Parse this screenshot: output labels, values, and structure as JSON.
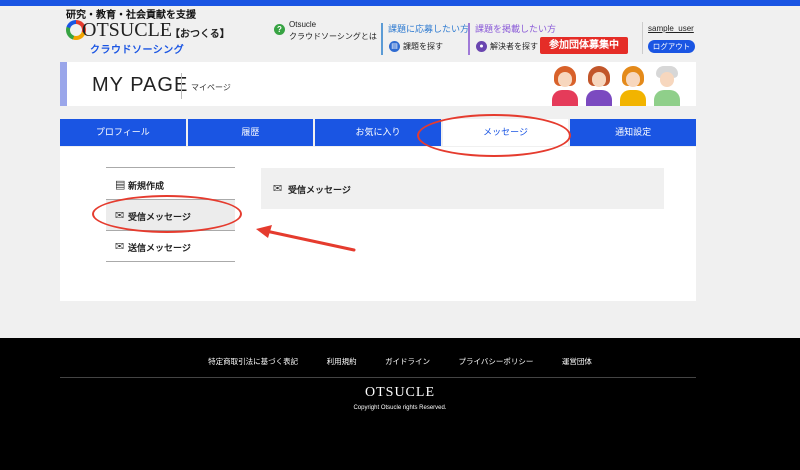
{
  "header": {
    "tagline": "研究・教育・社会貢献を支援",
    "logo_text": "OTSUCLE",
    "logo_sub": "【おつくる】",
    "logo_crowd": "クラウドソーシング",
    "about_line1": "Otsucle",
    "about_line2": "クラウドソーシングとは",
    "apply_title": "課題に応募したい方",
    "apply_action": "課題を探す",
    "post_title": "課題を掲載したい方",
    "post_action": "解決者を探す",
    "recruit_button": "参加団体募集中",
    "username": "sample_user",
    "logout": "ログアウト"
  },
  "banner": {
    "title": "MY PAGE",
    "subtitle": "マイページ"
  },
  "tabs": [
    {
      "label": "プロフィール",
      "active": false
    },
    {
      "label": "履歴",
      "active": false
    },
    {
      "label": "お気に入り",
      "active": false
    },
    {
      "label": "メッセージ",
      "active": true
    },
    {
      "label": "通知設定",
      "active": false
    }
  ],
  "sidebar": {
    "items": [
      {
        "label": "新規作成",
        "icon": "new-message-icon"
      },
      {
        "label": "受信メッセージ",
        "icon": "inbox-icon"
      },
      {
        "label": "送信メッセージ",
        "icon": "sent-icon"
      }
    ]
  },
  "panel": {
    "title": "受信メッセージ",
    "icon": "inbox-icon"
  },
  "footer": {
    "links": [
      "特定商取引法に基づく表記",
      "利用規約",
      "ガイドライン",
      "プライバシーポリシー",
      "運営団体"
    ],
    "logo": "OTSUCLE",
    "copyright": "Copyright Otsucle rights Reserved."
  },
  "colors": {
    "brand_blue": "#1a55e3",
    "recruit_red": "#e52d27",
    "annotation_red": "#e53b2e"
  }
}
